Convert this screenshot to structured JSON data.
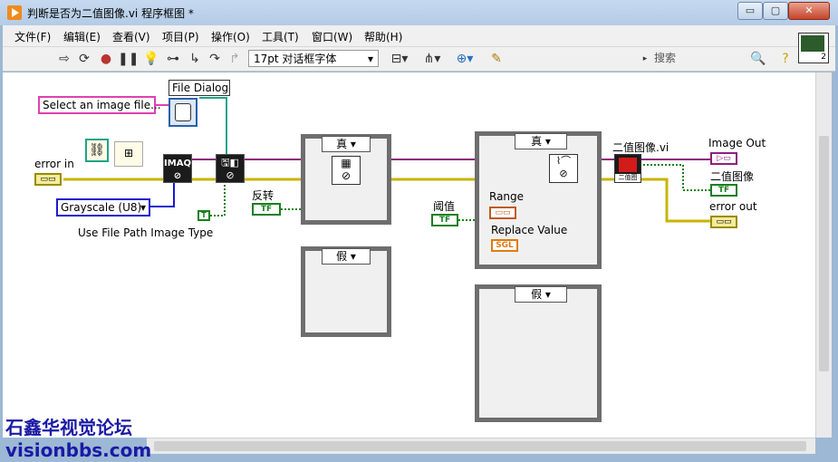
{
  "window": {
    "title": "判断是否为二值图像.vi 程序框图 *",
    "buttons": {
      "minimize": "▭",
      "maximize": "▢",
      "close": "✕"
    }
  },
  "menu": [
    "文件(F)",
    "编辑(E)",
    "查看(V)",
    "项目(P)",
    "操作(O)",
    "工具(T)",
    "窗口(W)",
    "帮助(H)"
  ],
  "toolbar": {
    "font": "17pt 对话框字体",
    "search_placeholder": "搜索",
    "vi_icon_number": "2"
  },
  "diagram": {
    "file_dialog_label": "File Dialog",
    "prompt_text": "Select an image file...",
    "error_in_label": "error in",
    "grayscale_value": "Grayscale (U8)",
    "use_file_path_label": "Use File Path Image Type",
    "imaq_text": "IMAQ",
    "invert_label": "反转",
    "threshold_label": "阈值",
    "case_true": "真",
    "case_false": "假",
    "range_label": "Range",
    "replace_value_label": "Replace Value",
    "subvi_label": "二值图像.vi",
    "image_out_label": "Image Out",
    "binary_image_label": "二值图像",
    "error_out_label": "error out",
    "tf": "TF",
    "t_const": "T",
    "sgl": "SGL"
  },
  "watermark": {
    "line1": "石鑫华视觉论坛",
    "line2": "visionbbs.com"
  },
  "colors": {
    "error_wire": "#c8b400",
    "image_wire": "#8e1f7e",
    "bool_wire": "#18801e",
    "orange": "#e07b12"
  }
}
